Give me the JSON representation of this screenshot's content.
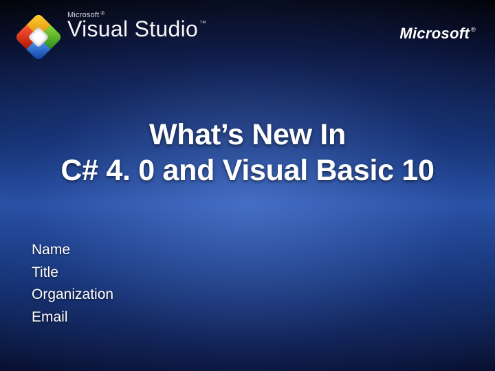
{
  "header": {
    "brand_small": "Microsoft",
    "registered": "®",
    "product": "Visual Studio",
    "trademark": "™",
    "corp": "Microsoft",
    "corp_registered": "®"
  },
  "title": {
    "line1": "What’s New In",
    "line2": "C# 4. 0 and Visual Basic 10"
  },
  "fields": {
    "name": "Name",
    "title": "Title",
    "organization": "Organization",
    "email": "Email"
  }
}
